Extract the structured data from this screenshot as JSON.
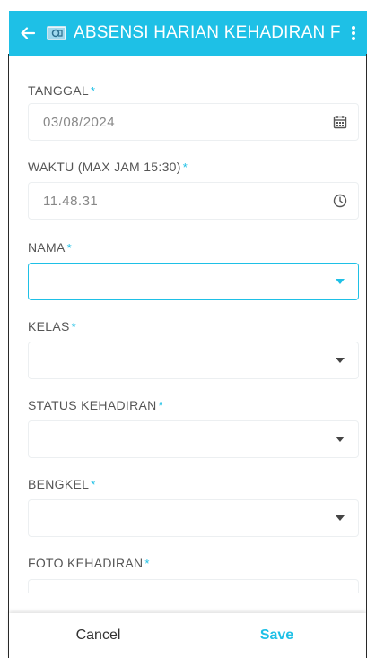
{
  "appbar": {
    "title": "ABSENSI HARIAN KEHADIRAN F",
    "color": "#1ec0e6"
  },
  "fields": {
    "tanggal": {
      "label": "TANGGAL",
      "value": "03/08/2024",
      "icon": "calendar-icon"
    },
    "waktu": {
      "label": "WAKTU (MAX JAM 15:30)",
      "value": "11.48.31",
      "icon": "clock-icon"
    },
    "nama": {
      "label": "NAMA",
      "value": ""
    },
    "kelas": {
      "label": "KELAS",
      "value": ""
    },
    "status": {
      "label": "STATUS KEHADIRAN",
      "value": ""
    },
    "bengkel": {
      "label": "BENGKEL",
      "value": ""
    },
    "foto": {
      "label": "FOTO KEHADIRAN",
      "icon": "camera-icon"
    }
  },
  "required_mark": "*",
  "buttons": {
    "cancel": "Cancel",
    "save": "Save"
  }
}
